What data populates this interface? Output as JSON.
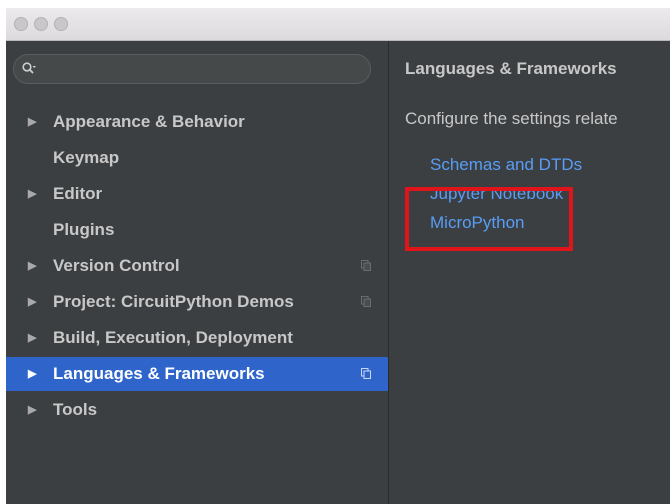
{
  "window": {
    "title": ""
  },
  "search": {
    "placeholder": "",
    "icon": "search-icon"
  },
  "sidebar": {
    "items": [
      {
        "label": "Appearance & Behavior",
        "expandable": true
      },
      {
        "label": "Keymap",
        "expandable": false
      },
      {
        "label": "Editor",
        "expandable": true
      },
      {
        "label": "Plugins",
        "expandable": false
      },
      {
        "label": "Version Control",
        "expandable": true,
        "project_icon": true
      },
      {
        "label": "Project: CircuitPython Demos",
        "expandable": true,
        "project_icon": true
      },
      {
        "label": "Build, Execution, Deployment",
        "expandable": true
      },
      {
        "label": "Languages & Frameworks",
        "expandable": true,
        "project_icon": true,
        "selected": true
      },
      {
        "label": "Tools",
        "expandable": true
      }
    ]
  },
  "content": {
    "title": "Languages & Frameworks",
    "description": "Configure the settings relate",
    "links": [
      {
        "label": "Schemas and DTDs"
      },
      {
        "label": "Jupyter Notebook"
      },
      {
        "label": "MicroPython"
      }
    ]
  },
  "colors": {
    "selection": "#2f65ca",
    "link": "#589df6",
    "highlight_box": "#e0141b",
    "panel_background": "#3c3f41"
  }
}
